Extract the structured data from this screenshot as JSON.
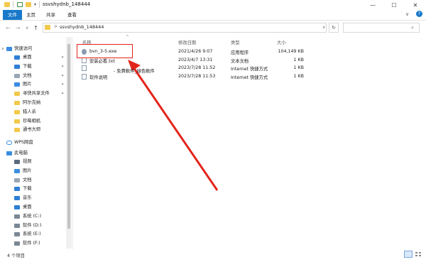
{
  "window": {
    "title": "ssvshydnb_148444",
    "minimize": "—",
    "maximize": "☐",
    "close": "✕"
  },
  "ribbon": {
    "tabs": [
      "文件",
      "主页",
      "共享",
      "查看"
    ],
    "collapse": "∨",
    "help": "?"
  },
  "address": {
    "back": "←",
    "forward": "→",
    "dropdown": "∨",
    "up": "↑",
    "separator": ">",
    "path": "ssvshydnb_148444",
    "address_dropdown": "∨",
    "refresh": "↻",
    "search_placeholder": ""
  },
  "nav": {
    "quick_access": "快速访问",
    "quick_items": [
      {
        "label": "桌面",
        "pinned": true,
        "icon": "desktop-icon"
      },
      {
        "label": "下载",
        "pinned": true,
        "icon": "download-icon"
      },
      {
        "label": "文档",
        "pinned": true,
        "icon": "document-icon"
      },
      {
        "label": "图片",
        "pinned": true,
        "icon": "picture-icon"
      },
      {
        "label": "寻快共享文件",
        "pinned": true,
        "icon": "folder-icon"
      },
      {
        "label": "阿尔克纳",
        "pinned": false,
        "icon": "folder-icon"
      },
      {
        "label": "猎人杀",
        "pinned": false,
        "icon": "folder-icon"
      },
      {
        "label": "珍莓相机",
        "pinned": false,
        "icon": "folder-icon"
      },
      {
        "label": "通书大师",
        "pinned": false,
        "icon": "folder-icon"
      }
    ],
    "wps": "WPS网盘",
    "this_pc": "此电脑",
    "pc_items": [
      {
        "label": "视频",
        "icon": "video-icon"
      },
      {
        "label": "图片",
        "icon": "picture-icon"
      },
      {
        "label": "文档",
        "icon": "document-icon"
      },
      {
        "label": "下载",
        "icon": "download-icon"
      },
      {
        "label": "音乐",
        "icon": "music-icon"
      },
      {
        "label": "桌面",
        "icon": "desktop-icon"
      },
      {
        "label": "系统 (C:)",
        "icon": "drive-icon"
      },
      {
        "label": "软件 (D:)",
        "icon": "drive-icon"
      },
      {
        "label": "系统 (E:)",
        "icon": "drive-icon"
      },
      {
        "label": "软件 (F:)",
        "icon": "drive-icon"
      }
    ]
  },
  "columns": {
    "name": "名称",
    "sort_indicator": "^",
    "modified": "修改日期",
    "type": "类型",
    "size": "大小"
  },
  "files": [
    {
      "name": "bvn_3-5.exe",
      "modified": "2021/4/26 9:07",
      "type": "应用程序",
      "size": "104,149 KB",
      "icon": "exe-icon"
    },
    {
      "name": "安装必看.txt",
      "modified": "2023/4/7 13:31",
      "type": "文本文档",
      "size": "1 KB",
      "icon": "txt-icon"
    },
    {
      "name": "",
      "modified": "2023/7/28 11:52",
      "type": "Internet 快捷方式",
      "size": "1 KB",
      "icon": "url-icon"
    },
    {
      "name": "软件说明",
      "modified": "2023/7/28 11:53",
      "type": "Internet 快捷方式",
      "size": "1 KB",
      "icon": "url-icon"
    }
  ],
  "overlay_text": "- 免費軟件_綠色軟件",
  "status": {
    "count": "4 个项目"
  },
  "colors": {
    "accent": "#1979ca",
    "highlight_red": "#e3241b",
    "folder": "#f2c94c"
  }
}
